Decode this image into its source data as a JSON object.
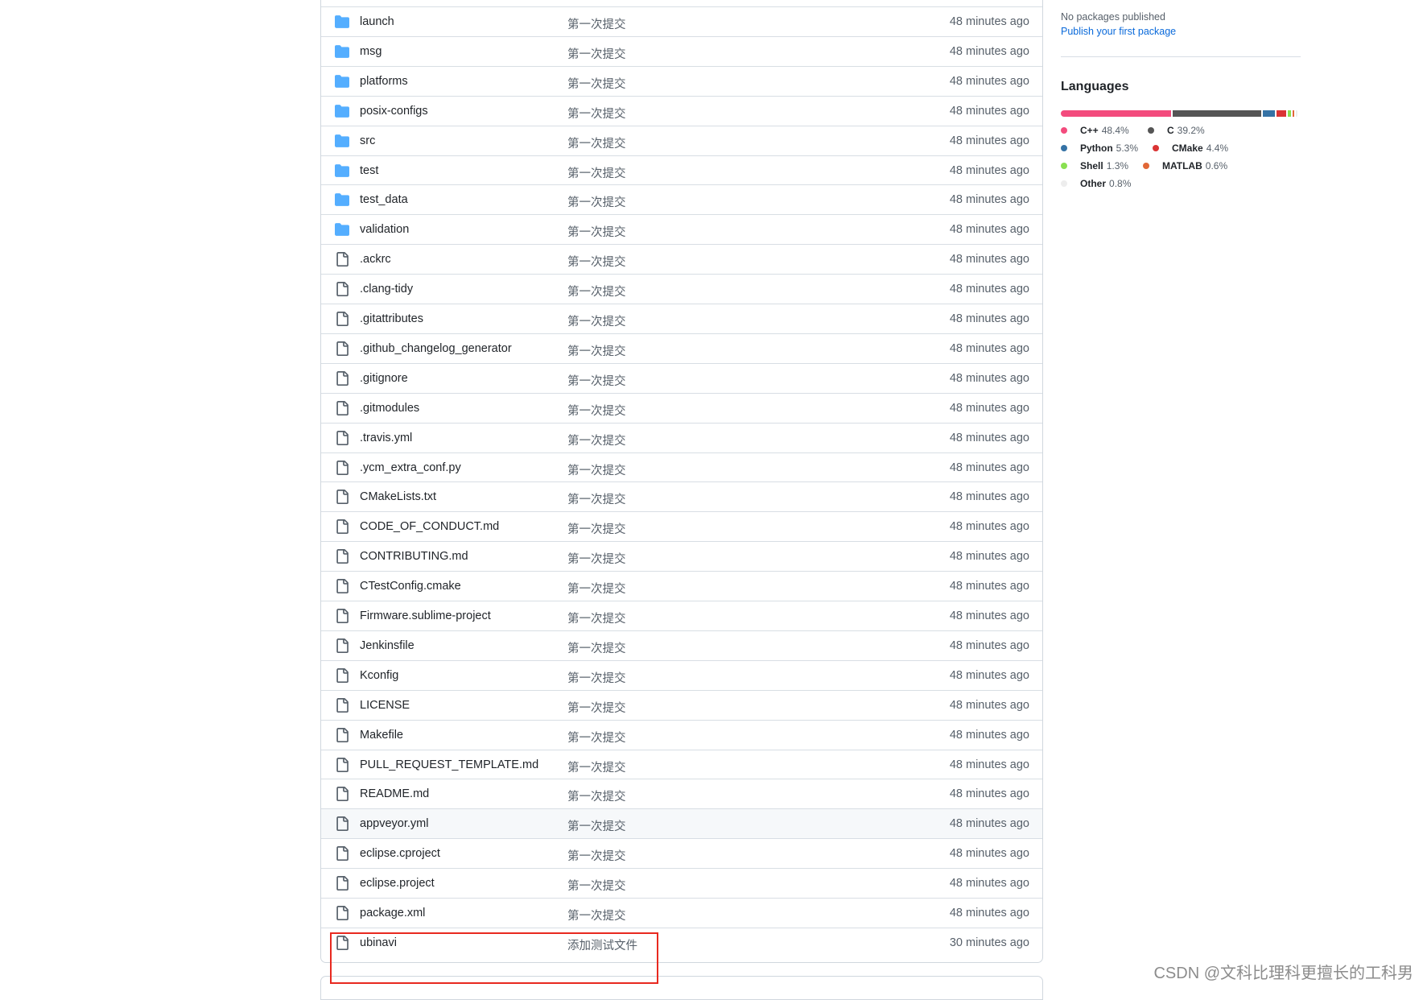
{
  "files": [
    {
      "type": "folder",
      "name": "launch",
      "message": "第一次提交",
      "age": "48 minutes ago"
    },
    {
      "type": "folder",
      "name": "msg",
      "message": "第一次提交",
      "age": "48 minutes ago"
    },
    {
      "type": "folder",
      "name": "platforms",
      "message": "第一次提交",
      "age": "48 minutes ago"
    },
    {
      "type": "folder",
      "name": "posix-configs",
      "message": "第一次提交",
      "age": "48 minutes ago"
    },
    {
      "type": "folder",
      "name": "src",
      "message": "第一次提交",
      "age": "48 minutes ago"
    },
    {
      "type": "folder",
      "name": "test",
      "message": "第一次提交",
      "age": "48 minutes ago"
    },
    {
      "type": "folder",
      "name": "test_data",
      "message": "第一次提交",
      "age": "48 minutes ago"
    },
    {
      "type": "folder",
      "name": "validation",
      "message": "第一次提交",
      "age": "48 minutes ago"
    },
    {
      "type": "file",
      "name": ".ackrc",
      "message": "第一次提交",
      "age": "48 minutes ago"
    },
    {
      "type": "file",
      "name": ".clang-tidy",
      "message": "第一次提交",
      "age": "48 minutes ago"
    },
    {
      "type": "file",
      "name": ".gitattributes",
      "message": "第一次提交",
      "age": "48 minutes ago"
    },
    {
      "type": "file",
      "name": ".github_changelog_generator",
      "message": "第一次提交",
      "age": "48 minutes ago"
    },
    {
      "type": "file",
      "name": ".gitignore",
      "message": "第一次提交",
      "age": "48 minutes ago"
    },
    {
      "type": "file",
      "name": ".gitmodules",
      "message": "第一次提交",
      "age": "48 minutes ago"
    },
    {
      "type": "file",
      "name": ".travis.yml",
      "message": "第一次提交",
      "age": "48 minutes ago"
    },
    {
      "type": "file",
      "name": ".ycm_extra_conf.py",
      "message": "第一次提交",
      "age": "48 minutes ago"
    },
    {
      "type": "file",
      "name": "CMakeLists.txt",
      "message": "第一次提交",
      "age": "48 minutes ago"
    },
    {
      "type": "file",
      "name": "CODE_OF_CONDUCT.md",
      "message": "第一次提交",
      "age": "48 minutes ago"
    },
    {
      "type": "file",
      "name": "CONTRIBUTING.md",
      "message": "第一次提交",
      "age": "48 minutes ago"
    },
    {
      "type": "file",
      "name": "CTestConfig.cmake",
      "message": "第一次提交",
      "age": "48 minutes ago"
    },
    {
      "type": "file",
      "name": "Firmware.sublime-project",
      "message": "第一次提交",
      "age": "48 minutes ago"
    },
    {
      "type": "file",
      "name": "Jenkinsfile",
      "message": "第一次提交",
      "age": "48 minutes ago"
    },
    {
      "type": "file",
      "name": "Kconfig",
      "message": "第一次提交",
      "age": "48 minutes ago"
    },
    {
      "type": "file",
      "name": "LICENSE",
      "message": "第一次提交",
      "age": "48 minutes ago"
    },
    {
      "type": "file",
      "name": "Makefile",
      "message": "第一次提交",
      "age": "48 minutes ago"
    },
    {
      "type": "file",
      "name": "PULL_REQUEST_TEMPLATE.md",
      "message": "第一次提交",
      "age": "48 minutes ago"
    },
    {
      "type": "file",
      "name": "README.md",
      "message": "第一次提交",
      "age": "48 minutes ago"
    },
    {
      "type": "file",
      "name": "appveyor.yml",
      "message": "第一次提交",
      "age": "48 minutes ago",
      "highlighted": true
    },
    {
      "type": "file",
      "name": "eclipse.cproject",
      "message": "第一次提交",
      "age": "48 minutes ago"
    },
    {
      "type": "file",
      "name": "eclipse.project",
      "message": "第一次提交",
      "age": "48 minutes ago"
    },
    {
      "type": "file",
      "name": "package.xml",
      "message": "第一次提交",
      "age": "48 minutes ago"
    },
    {
      "type": "file",
      "name": "ubinavi",
      "message": "添加测试文件",
      "age": "30 minutes ago"
    }
  ],
  "packages": {
    "none_text": "No packages published",
    "publish_link": "Publish your first package"
  },
  "languages": {
    "title": "Languages",
    "items": [
      {
        "name": "C++",
        "percent": "48.4%",
        "value": 48.4,
        "color": "#f34b7d"
      },
      {
        "name": "C",
        "percent": "39.2%",
        "value": 39.2,
        "color": "#555555"
      },
      {
        "name": "Python",
        "percent": "5.3%",
        "value": 5.3,
        "color": "#3572a5"
      },
      {
        "name": "CMake",
        "percent": "4.4%",
        "value": 4.4,
        "color": "#da3434"
      },
      {
        "name": "Shell",
        "percent": "1.3%",
        "value": 1.3,
        "color": "#89e051"
      },
      {
        "name": "MATLAB",
        "percent": "0.6%",
        "value": 0.6,
        "color": "#e16737"
      },
      {
        "name": "Other",
        "percent": "0.8%",
        "value": 0.8,
        "color": "#ededed"
      }
    ]
  },
  "colors": {
    "folder": "#54aeff",
    "file": "#57606a",
    "annotation": "#e8291f"
  },
  "watermark": "CSDN @文科比理科更擅长的工科男"
}
